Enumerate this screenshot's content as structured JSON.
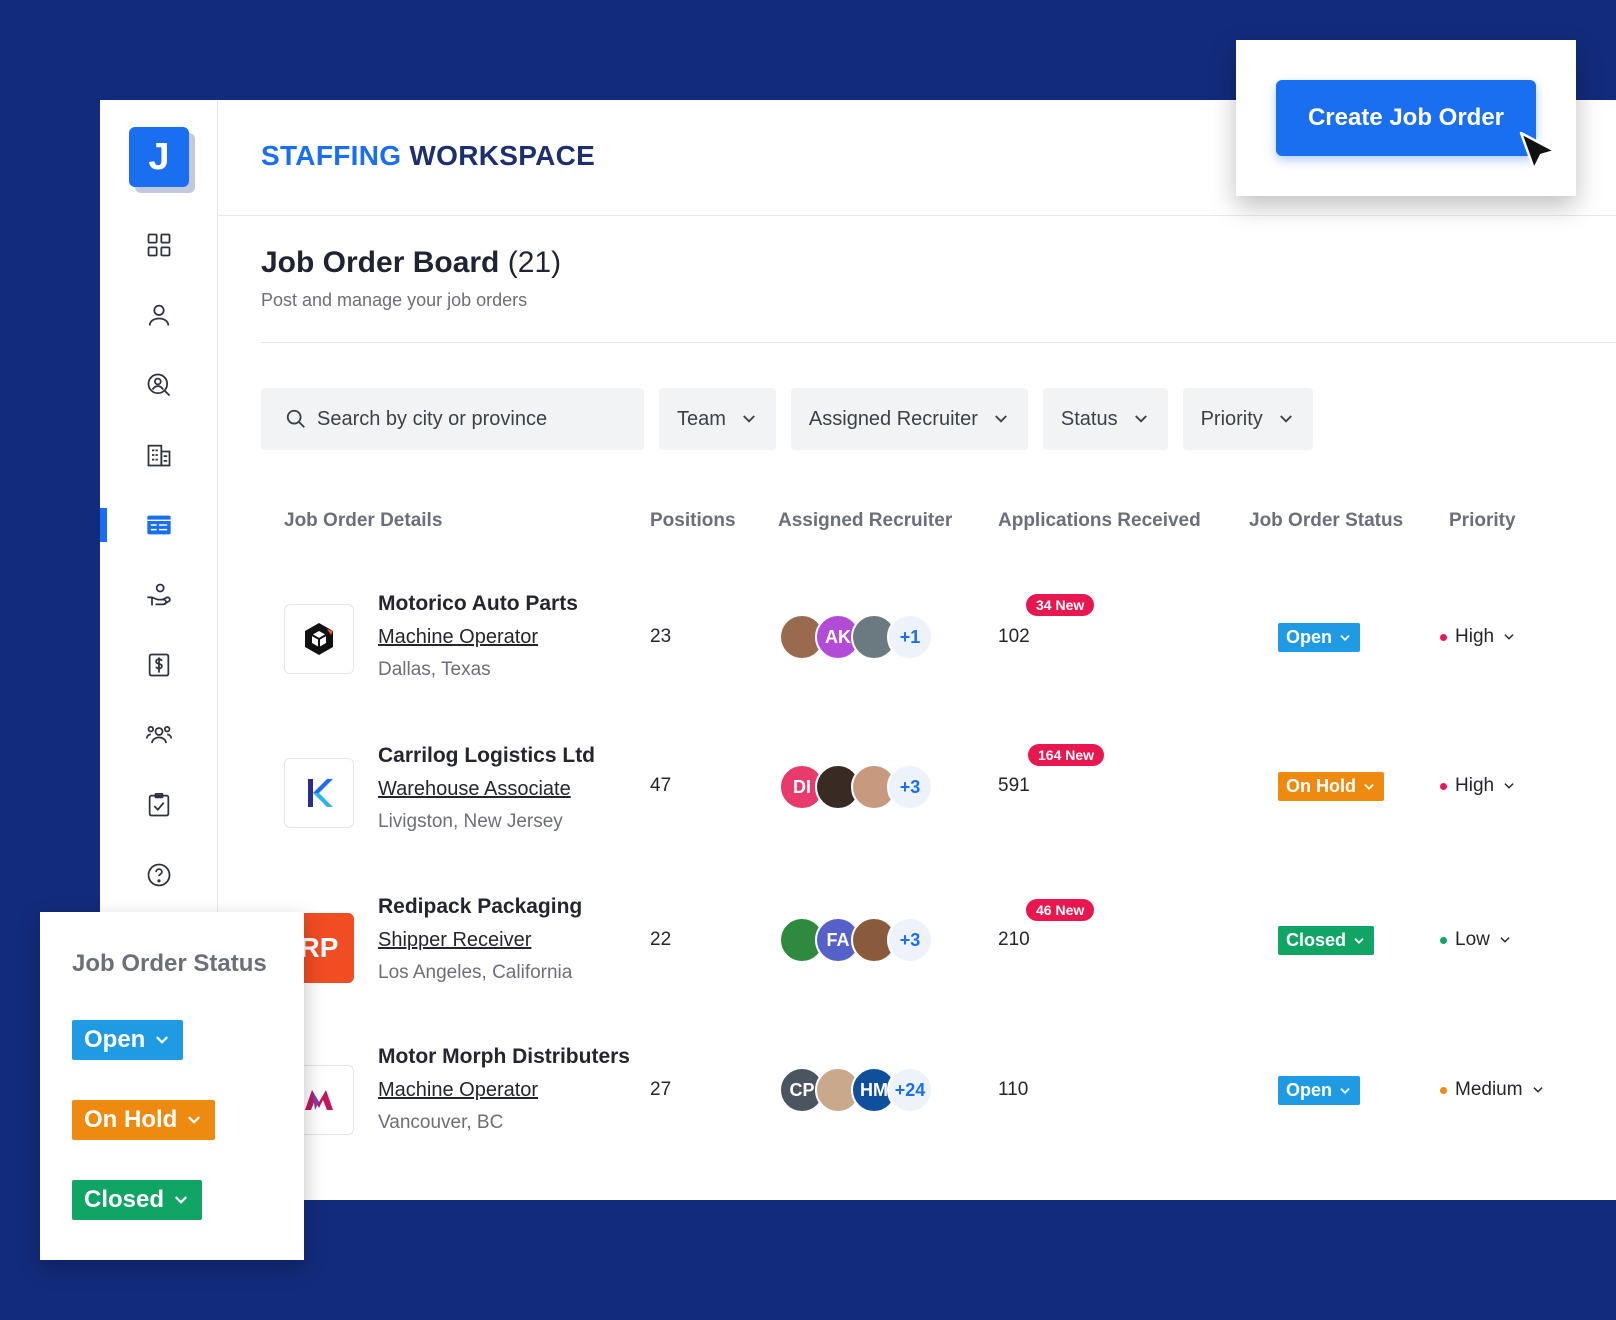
{
  "app": {
    "logo_letter": "J",
    "brand_part1": "STAFFING",
    "brand_part2": "WORKSPACE",
    "create_button": "Create Job Order"
  },
  "sidebar": {
    "items": [
      {
        "icon": "dashboard-icon",
        "active": false
      },
      {
        "icon": "user-icon",
        "active": false
      },
      {
        "icon": "candidate-search-icon",
        "active": false
      },
      {
        "icon": "building-icon",
        "active": false
      },
      {
        "icon": "job-board-icon",
        "active": true
      },
      {
        "icon": "placement-hand-icon",
        "active": false
      },
      {
        "icon": "billing-dollar-icon",
        "active": false
      },
      {
        "icon": "team-icon",
        "active": false
      },
      {
        "icon": "tasks-clipboard-icon",
        "active": false
      },
      {
        "icon": "help-icon",
        "active": false
      }
    ]
  },
  "board": {
    "title": "Job Order Board",
    "count": "(21)",
    "subtitle": "Post and manage your job orders"
  },
  "filters": {
    "search_placeholder": "Search by city or province",
    "team": "Team",
    "recruiter": "Assigned Recruiter",
    "status": "Status",
    "priority": "Priority"
  },
  "table": {
    "headers": [
      "Job Order Details",
      "Positions",
      "Assigned Recruiter",
      "Applications Received",
      "Job Order Status",
      "Priority"
    ],
    "rows": [
      {
        "company": "Motorico Auto Parts",
        "role": "Machine Operator",
        "location": "Dallas, Texas",
        "positions": "23",
        "avatars": [
          {
            "initials": "",
            "color": "#9a6a4f"
          },
          {
            "initials": "AK",
            "color": "#b24bd6"
          },
          {
            "initials": "",
            "color": "#6a7a80"
          }
        ],
        "avatars_more": "+1",
        "applications": "102",
        "new_badge": "34 New",
        "status": "Open",
        "status_color": "#1e9be3",
        "priority": "High",
        "priority_color": "#e8174f"
      },
      {
        "company": "Carrilog Logistics Ltd",
        "role": "Warehouse Associate",
        "location": "Livigston, New Jersey",
        "positions": "47",
        "avatars": [
          {
            "initials": "DI",
            "color": "#e93a6c"
          },
          {
            "initials": "",
            "color": "#3a2a24"
          },
          {
            "initials": "",
            "color": "#c79a80"
          }
        ],
        "avatars_more": "+3",
        "applications": "591",
        "new_badge": "164 New",
        "status": "On Hold",
        "status_color": "#ee8a0f",
        "priority": "High",
        "priority_color": "#e8174f"
      },
      {
        "company": "Redipack Packaging",
        "role": "Shipper Receiver",
        "location": "Los Angeles, California",
        "positions": "22",
        "logo_text": "RP",
        "avatars": [
          {
            "initials": "",
            "color": "#2f8a3f"
          },
          {
            "initials": "FA",
            "color": "#5561c8"
          },
          {
            "initials": "",
            "color": "#8a5a3c"
          }
        ],
        "avatars_more": "+3",
        "applications": "210",
        "new_badge": "46 New",
        "status": "Closed",
        "status_color": "#11a565",
        "priority": "Low",
        "priority_color": "#11a565"
      },
      {
        "company": "Motor Morph Distributers",
        "role": "Machine Operator",
        "location": "Vancouver, BC",
        "positions": "27",
        "avatars": [
          {
            "initials": "CP",
            "color": "#4a5560"
          },
          {
            "initials": "",
            "color": "#c9a88c"
          },
          {
            "initials": "HM",
            "color": "#0f4f9c"
          }
        ],
        "avatars_more": "+24",
        "applications": "110",
        "new_badge": "",
        "status": "Open",
        "status_color": "#1e9be3",
        "priority": "Medium",
        "priority_color": "#ee8a0f"
      }
    ]
  },
  "status_legend": {
    "title": "Job Order Status",
    "items": [
      {
        "label": "Open",
        "color": "#1e9be3"
      },
      {
        "label": "On Hold",
        "color": "#ee8a0f"
      },
      {
        "label": "Closed",
        "color": "#11a565"
      }
    ]
  }
}
